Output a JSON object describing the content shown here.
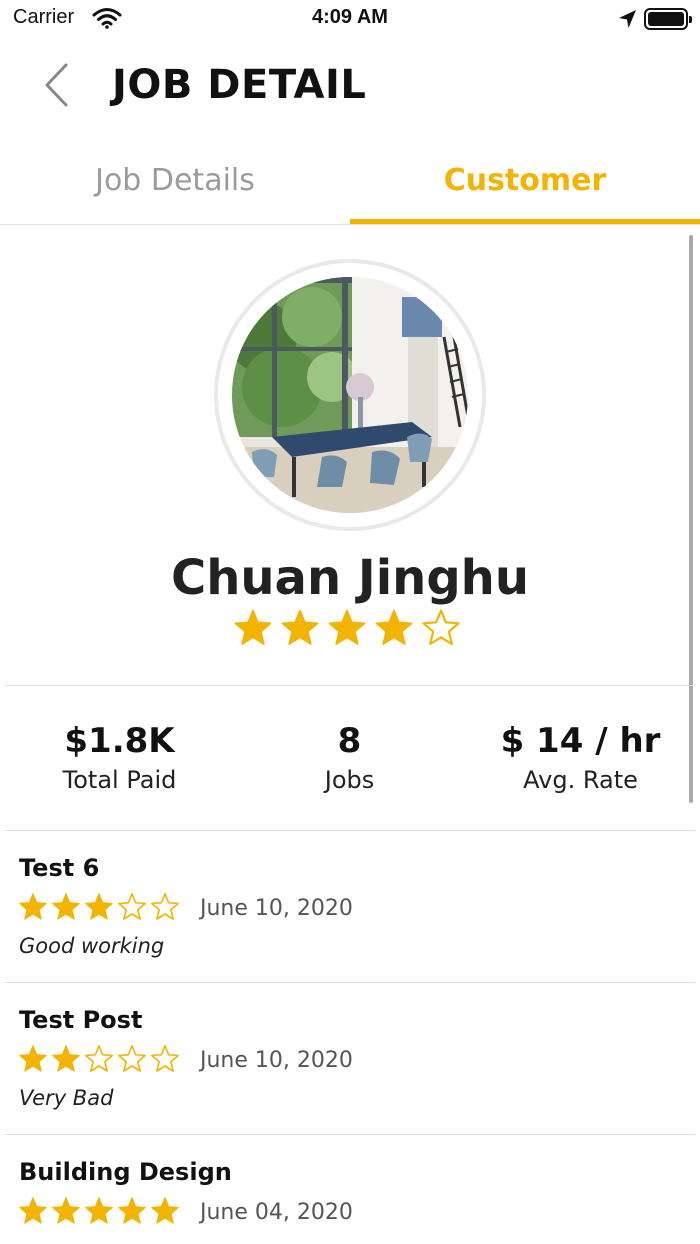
{
  "status_bar": {
    "carrier": "Carrier",
    "time": "4:09 AM",
    "icons": [
      "wifi-icon",
      "location-arrow-icon",
      "battery-icon"
    ]
  },
  "header": {
    "title": "JOB DETAIL",
    "back_icon": "chevron-left-icon"
  },
  "tabs": [
    {
      "label": "Job Details",
      "active": false
    },
    {
      "label": "Customer",
      "active": true
    }
  ],
  "colors": {
    "accent": "#f2b400",
    "inactive_tab": "#9b9b9b",
    "star": "#f2b400"
  },
  "customer": {
    "name": "Chuan Jinghu",
    "rating": 4,
    "rating_max": 5,
    "avatar": "photo of modern dining room with blue table and chairs"
  },
  "stats": [
    {
      "value": "$1.8K",
      "label": "Total Paid"
    },
    {
      "value": "8",
      "label": "Jobs"
    },
    {
      "value": "$ 14 / hr",
      "label": "Avg. Rate"
    }
  ],
  "reviews": [
    {
      "title": "Test 6",
      "rating": 3,
      "date": "June 10, 2020",
      "comment": "Good working"
    },
    {
      "title": "Test Post",
      "rating": 2,
      "date": "June 10, 2020",
      "comment": "Very Bad"
    },
    {
      "title": "Building Design",
      "rating": 5,
      "date": "June 04, 2020",
      "comment": ""
    }
  ]
}
